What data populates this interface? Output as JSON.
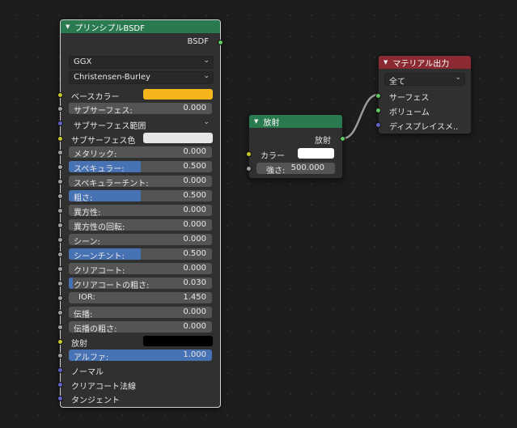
{
  "principled": {
    "title": "プリンシプルBSDF",
    "header_color": "#2a7a50",
    "output_label": "BSDF",
    "distribution": "GGX",
    "subsurface_method": "Christensen-Burley",
    "base_color_label": "ベースカラー",
    "base_color": "#f5b41a",
    "subsurface_label": "サブサーフェス:",
    "subsurface_value": "0.000",
    "subsurface_radius_label": "サブサーフェス範囲",
    "subsurface_color_label": "サブサーフェス色",
    "subsurface_color": "#e6e6e6",
    "metallic_label": "メタリック:",
    "metallic_value": "0.000",
    "specular_label": "スペキュラー:",
    "specular_value": "0.500",
    "specular_fill": 0.5,
    "specular_tint_label": "スペキュラーチント:",
    "specular_tint_value": "0.000",
    "roughness_label": "粗さ:",
    "roughness_value": "0.500",
    "roughness_fill": 0.5,
    "anisotropic_label": "異方性:",
    "anisotropic_value": "0.000",
    "anisotropic_rotation_label": "異方性の回転:",
    "anisotropic_rotation_value": "0.000",
    "sheen_label": "シーン:",
    "sheen_value": "0.000",
    "sheen_tint_label": "シーンチント:",
    "sheen_tint_value": "0.500",
    "sheen_tint_fill": 0.5,
    "clearcoat_label": "クリアコート:",
    "clearcoat_value": "0.000",
    "clearcoat_roughness_label": "クリアコートの粗さ:",
    "clearcoat_roughness_value": "0.030",
    "clearcoat_roughness_fill": 0.03,
    "ior_label": "IOR:",
    "ior_value": "1.450",
    "transmission_label": "伝播:",
    "transmission_value": "0.000",
    "transmission_roughness_label": "伝播の粗さ:",
    "transmission_roughness_value": "0.000",
    "emission_label": "放射",
    "emission_color": "#000000",
    "alpha_label": "アルファ:",
    "alpha_value": "1.000",
    "alpha_fill": 1.0,
    "normal_label": "ノーマル",
    "clearcoat_normal_label": "クリアコート法線",
    "tangent_label": "タンジェント"
  },
  "emission": {
    "title": "放射",
    "header_color": "#2a7a50",
    "output_label": "放射",
    "color_label": "カラー",
    "color": "#ffffff",
    "strength_label": "強さ:",
    "strength_value": "500.000"
  },
  "material_output": {
    "title": "マテリアル出力",
    "header_color": "#8c2a33",
    "target": "全て",
    "surface_label": "サーフェス",
    "volume_label": "ボリューム",
    "displacement_label": "ディスプレイスメ.."
  },
  "icons": {
    "collapse": "triangle-down-icon",
    "dropdown": "chevron-down-icon"
  }
}
